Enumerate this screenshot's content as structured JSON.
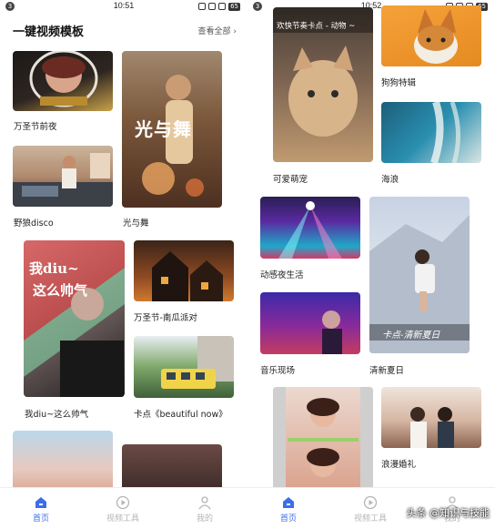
{
  "left": {
    "status_time": "10:51",
    "status_badge": "3",
    "battery": "65",
    "header": {
      "title": "一键视频模板",
      "more": "查看全部"
    },
    "cards": {
      "halloween_eve": "万圣节前夜",
      "wild_disco": "野狼disco",
      "light_dance": "光与舞",
      "handsome": "我diu~这么帅气",
      "pumpkin_party": "万圣节-南瓜派对",
      "beautiful_now": "卡点《beautiful now》"
    },
    "overlays": {
      "light_dance": "光与舞",
      "handsome_line1": "我diu~",
      "handsome_line2": "这么帅气"
    }
  },
  "right": {
    "status_time": "10:52",
    "status_badge": "3",
    "battery": "65",
    "cards": {
      "cute_pets": "可爱萌宠",
      "corgi": "狗狗特辑",
      "waves": "海浪",
      "nightlife": "动感夜生活",
      "live_music": "音乐现场",
      "summer": "清新夏日",
      "wedding": "浪漫婚礼"
    },
    "overlays": {
      "cat_banner": "欢快节奏卡点 - 动物 ~",
      "summer_banner": "卡点-清新夏日"
    }
  },
  "tabs": [
    {
      "label": "首页",
      "icon": "home-icon",
      "active": true
    },
    {
      "label": "视频工具",
      "icon": "play-circle-icon",
      "active": false
    },
    {
      "label": "我的",
      "icon": "user-icon",
      "active": false
    }
  ],
  "watermark": "头条 @知识与技能",
  "colors": {
    "accent": "#3b6fe8",
    "inactive": "#b5b5b5"
  }
}
